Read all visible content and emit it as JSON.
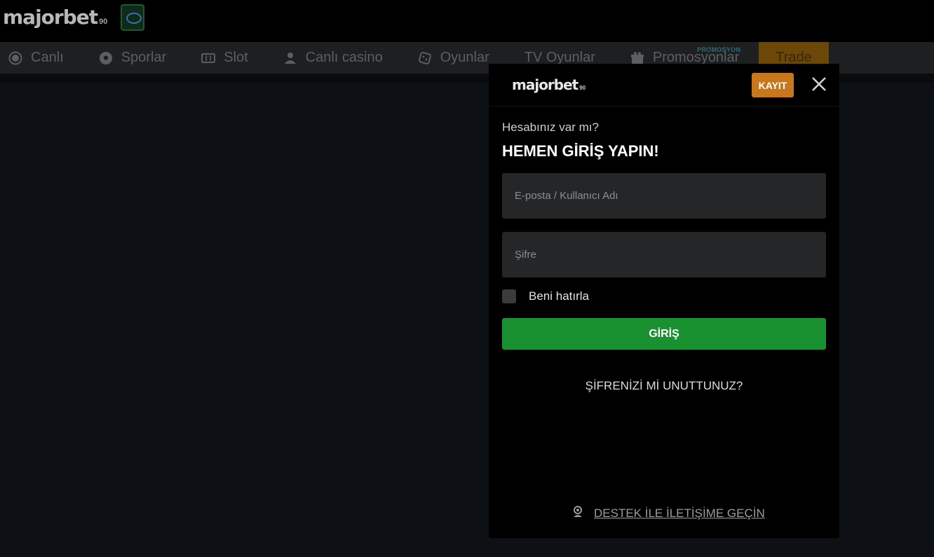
{
  "header": {
    "logo_text": "majorbet",
    "logo_suffix": "90"
  },
  "nav": {
    "items": [
      {
        "label": "Canlı",
        "icon": "live-icon"
      },
      {
        "label": "Sporlar",
        "icon": "soccer-ball-icon"
      },
      {
        "label": "Slot",
        "icon": "slot-machine-icon"
      },
      {
        "label": "Canlı casino",
        "icon": "dealer-icon"
      },
      {
        "label": "Oyunlar",
        "icon": "dice-icon"
      },
      {
        "label": "TV Oyunlar",
        "icon": ""
      },
      {
        "label": "Promosyonlar",
        "icon": "gift-icon",
        "tag": "PROMOSYON"
      }
    ],
    "trade_label": "Trade"
  },
  "modal": {
    "logo_text": "majorbet",
    "logo_suffix": "90",
    "register_label": "KAYIT",
    "question": "Hesabınız var mı?",
    "heading": "HEMEN GİRİŞ YAPIN!",
    "username_placeholder": "E-posta / Kullanıcı Adı",
    "password_placeholder": "Şifre",
    "remember_label": "Beni hatırla",
    "login_label": "GİRİŞ",
    "forgot_label": "ŞİFRENİZİ Mİ UNUTTUNUZ?",
    "support_label": "DESTEK İLE İLETİŞİME GEÇİN"
  },
  "colors": {
    "accent": "#c8771a",
    "login_green": "#1a9130",
    "field_bg": "#252627"
  }
}
